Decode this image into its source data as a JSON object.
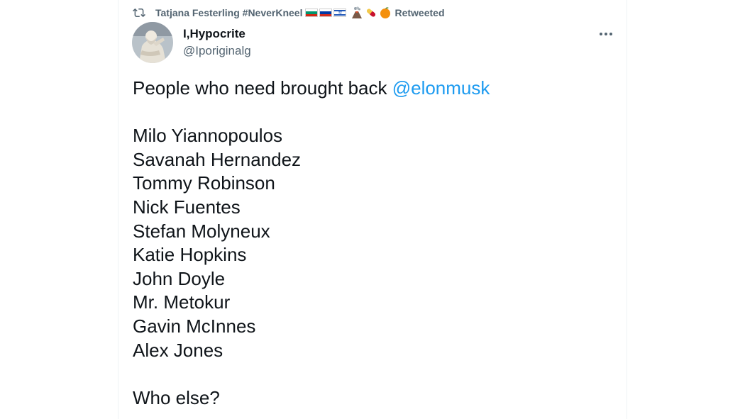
{
  "retweet": {
    "icon": "retweet-icon",
    "user_name": "Tatjana Festerling #NeverKneel",
    "flags": [
      "bulgaria-flag",
      "russia-flag",
      "israel-flag"
    ],
    "emoji_icons": [
      "volcano-icon",
      "pill-icon",
      "orange-icon"
    ],
    "label": "Retweeted"
  },
  "tweet": {
    "author_name": "I,Hypocrite",
    "author_handle": "@Iporiginalg",
    "intro_text": "People who need brought back ",
    "mention": "@elonmusk",
    "names": [
      "Milo Yiannopoulos",
      "Savanah Hernandez",
      "Tommy Robinson",
      "Nick Fuentes",
      "Stefan Molyneux",
      "Katie Hopkins",
      "John Doyle",
      "Mr. Metokur",
      "Gavin McInnes",
      "Alex Jones"
    ],
    "closing_text": "Who else?"
  },
  "colors": {
    "accent": "#1d9bf0",
    "primary_text": "#0f1419",
    "secondary_text": "#536471"
  }
}
